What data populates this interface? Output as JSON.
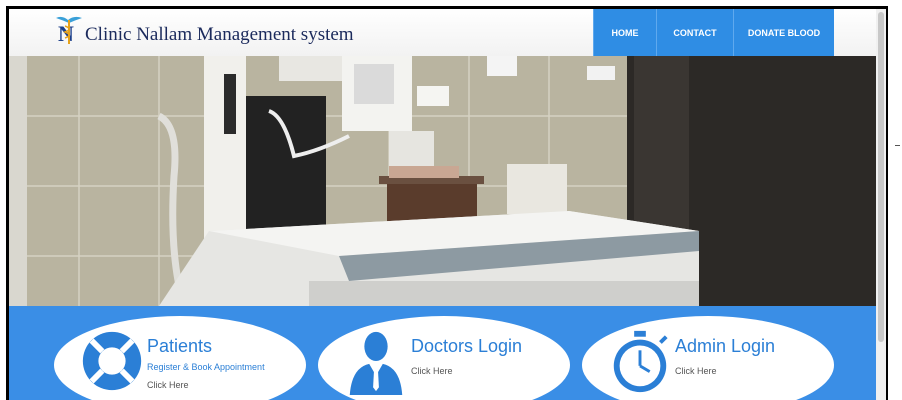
{
  "header": {
    "brand": "Clinic Nallam Management system",
    "logo_icon": "caduceus-n-logo-icon"
  },
  "nav": [
    {
      "label": "HOME"
    },
    {
      "label": "CONTACT"
    },
    {
      "label": "DONATE BLOOD"
    }
  ],
  "hero": {
    "image": "x-ray-room-photo"
  },
  "cards": [
    {
      "title": "Patients",
      "subtitle": "Register & Book Appointment",
      "action": "Click Here",
      "icon": "lifebuoy-icon"
    },
    {
      "title": "Doctors Login",
      "action": "Click Here",
      "icon": "doctor-icon"
    },
    {
      "title": "Admin Login",
      "action": "Click Here",
      "icon": "stopwatch-icon"
    }
  ],
  "colors": {
    "nav": "#2f8de4",
    "panel": "#3a8ee6",
    "card_text": "#2b7fd6",
    "brand": "#1b2a5c"
  }
}
